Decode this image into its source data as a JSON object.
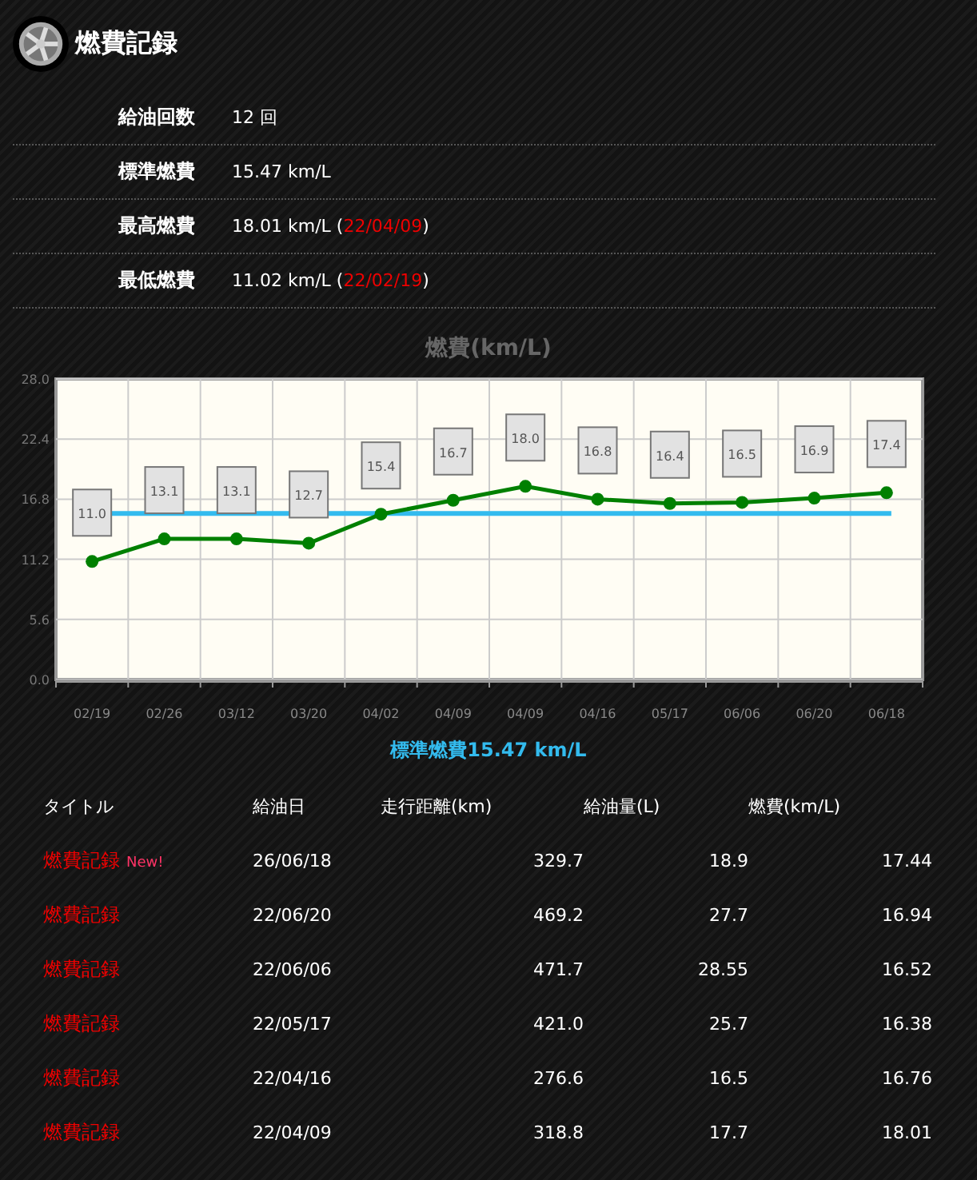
{
  "header": {
    "title": "燃費記録"
  },
  "stats": [
    {
      "label": "給油回数",
      "value": "12 回"
    },
    {
      "label": "標準燃費",
      "value": "15.47 km/L"
    },
    {
      "label": "最高燃費",
      "value": "18.01 km/L",
      "date_prefix": "(",
      "date": "22/04/09",
      "date_suffix": ")"
    },
    {
      "label": "最低燃費",
      "value": "11.02 km/L",
      "date_prefix": "(",
      "date": "22/02/19",
      "date_suffix": ")"
    }
  ],
  "chart": {
    "chart_data": {
      "type": "line",
      "title": "燃費(km/L)",
      "categories": [
        "02/19",
        "02/26",
        "03/12",
        "03/20",
        "04/02",
        "04/09",
        "04/09",
        "04/16",
        "05/17",
        "06/06",
        "06/20",
        "06/18"
      ],
      "series": [
        {
          "color": "#008000",
          "marker": "circle",
          "values": [
            11.0,
            13.1,
            13.1,
            12.7,
            15.4,
            16.7,
            18.0,
            16.8,
            16.4,
            16.5,
            16.9,
            17.4
          ]
        }
      ],
      "value_labels": [
        "11.0",
        "13.1",
        "13.1",
        "12.7",
        "15.4",
        "16.7",
        "18.0",
        "16.8",
        "16.4",
        "16.5",
        "16.9",
        "17.4"
      ],
      "grid": true,
      "ylim": [
        0,
        28
      ],
      "yticks": [
        {
          "value": 0,
          "label": "0.0"
        },
        {
          "value": 5.6,
          "label": "5.6"
        },
        {
          "value": 11.2,
          "label": "11.2"
        },
        {
          "value": 16.8,
          "label": "16.8"
        },
        {
          "value": 22.4,
          "label": "22.4"
        },
        {
          "value": 28,
          "label": "28.0"
        }
      ],
      "ref_lines": [
        {
          "axis": "y",
          "value": 15.47,
          "label": "標準燃費15.47 km/L",
          "color": "#33bbee"
        }
      ]
    }
  },
  "table": {
    "columns": [
      "タイトル",
      "給油日",
      "走行距離(km)",
      "給油量(L)",
      "燃費(km/L)"
    ],
    "rows": [
      {
        "title": "燃費記録",
        "badge": "New!",
        "date": "26/06/18",
        "distance": "329.7",
        "fuel": "18.9",
        "mileage": "17.44"
      },
      {
        "title": "燃費記録",
        "date": "22/06/20",
        "distance": "469.2",
        "fuel": "27.7",
        "mileage": "16.94"
      },
      {
        "title": "燃費記録",
        "date": "22/06/06",
        "distance": "471.7",
        "fuel": "28.55",
        "mileage": "16.52"
      },
      {
        "title": "燃費記録",
        "date": "22/05/17",
        "distance": "421.0",
        "fuel": "25.7",
        "mileage": "16.38"
      },
      {
        "title": "燃費記録",
        "date": "22/04/16",
        "distance": "276.6",
        "fuel": "16.5",
        "mileage": "16.76"
      },
      {
        "title": "燃費記録",
        "date": "22/04/09",
        "distance": "318.8",
        "fuel": "17.7",
        "mileage": "18.01"
      }
    ]
  }
}
